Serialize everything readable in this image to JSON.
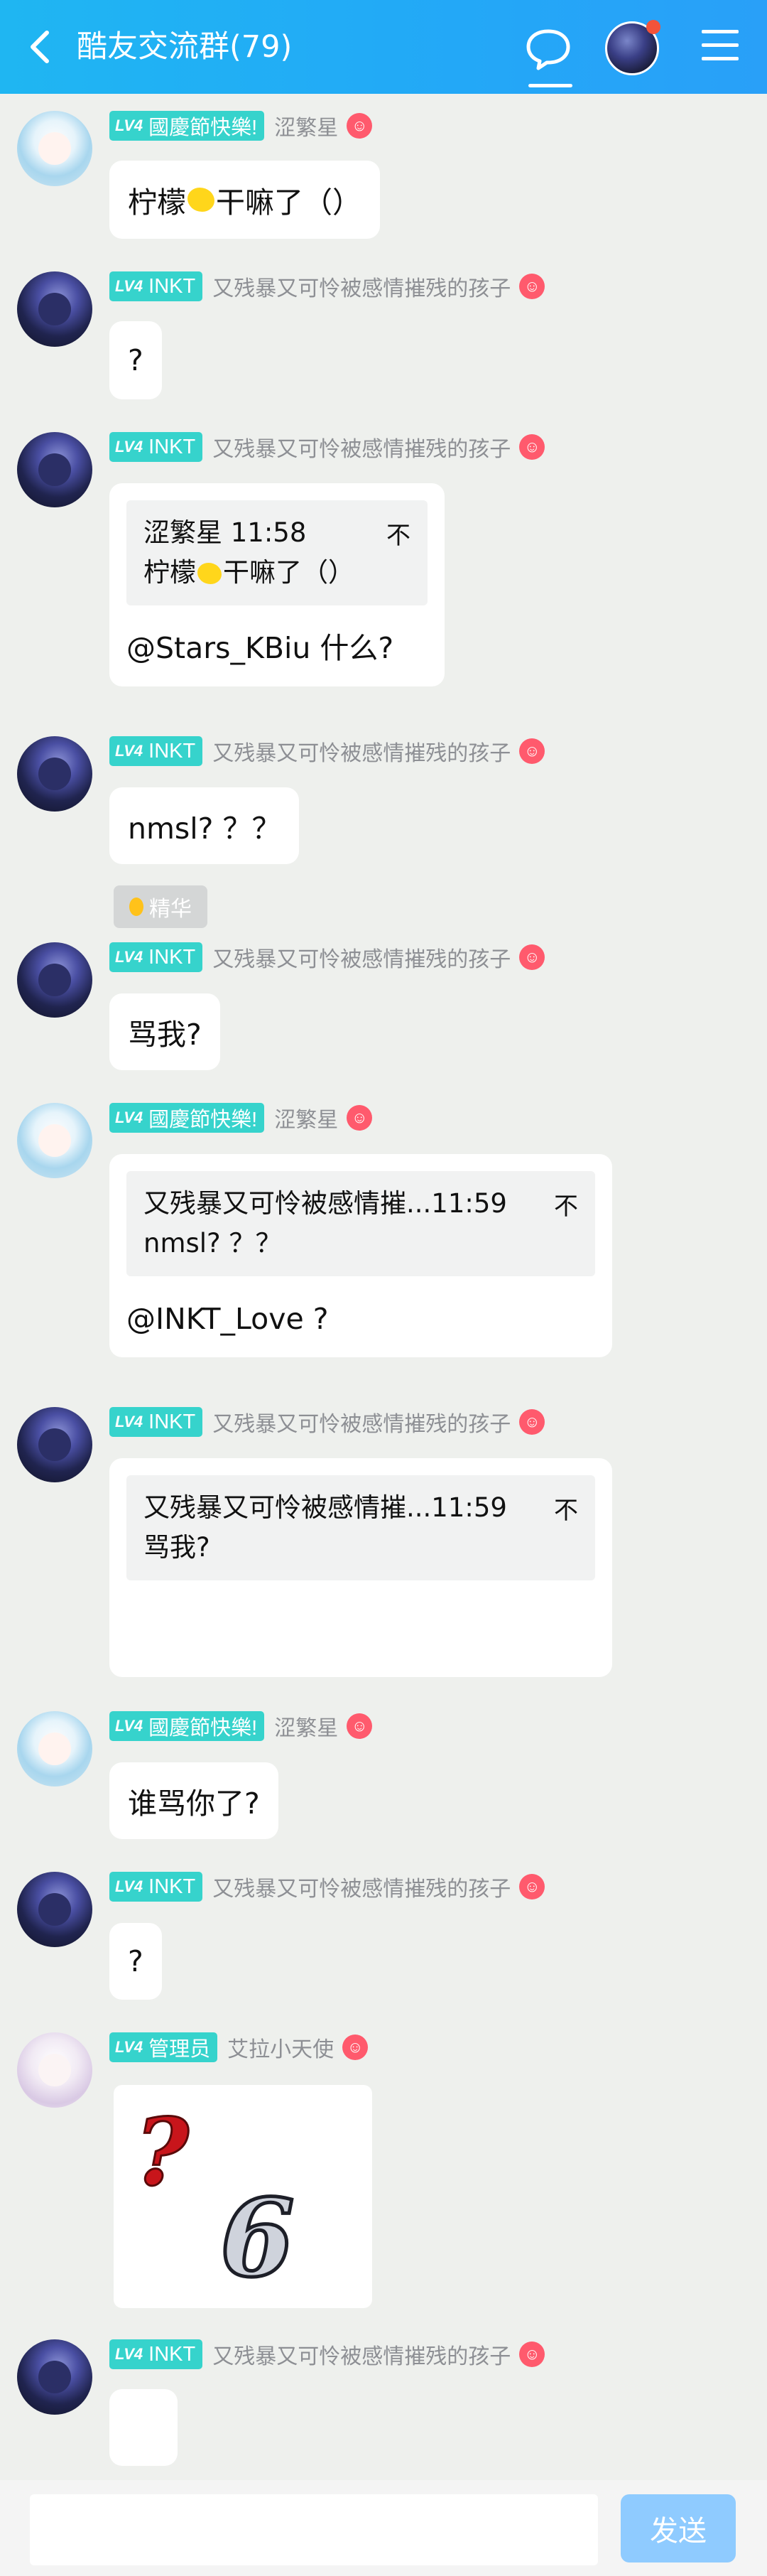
{
  "header": {
    "title": "酷友交流群(79)",
    "back_icon": "chevron-left-icon",
    "chat_icon": "chat-bubble-icon",
    "menu_icon": "hamburger-menu-icon",
    "accent": "#23a8f7"
  },
  "users": {
    "sejing": {
      "badge": "國慶節快樂!",
      "name": "涩繁星"
    },
    "inkt": {
      "badge": "INKT",
      "name": "又残暴又可怜被感情摧残的孩子"
    },
    "admin": {
      "badge": "管理员",
      "name": "艾拉小天使"
    }
  },
  "level": "LV4",
  "messages": [
    {
      "text_before": "柠檬",
      "text_after": "干嘛了（）"
    },
    {
      "text": "?"
    },
    {
      "quote_head": "涩繁星 11:58",
      "quote_before": "柠檬",
      "quote_after": "干嘛了（）",
      "reply": "@Stars_KBiu 什么?"
    },
    {
      "text": "nmsl? ？？"
    },
    {
      "text": "骂我?"
    },
    {
      "quote_head": "又残暴又可怜被感情摧...11:59",
      "quote_body": "nmsl? ？？",
      "reply": "@INKT_Love ?"
    },
    {
      "quote_head": "又残暴又可怜被感情摧...11:59",
      "quote_body": "骂我?"
    },
    {
      "text": "谁骂你了?"
    },
    {
      "text": "?"
    }
  ],
  "pin_glyph": "不",
  "essence_label": "精华",
  "composer": {
    "placeholder": "",
    "send_label": "发送"
  }
}
